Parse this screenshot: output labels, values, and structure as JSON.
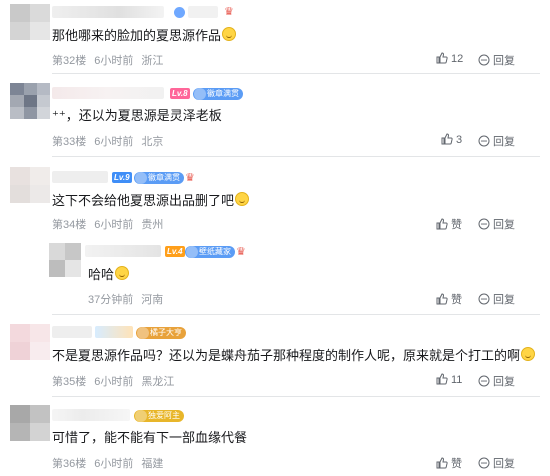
{
  "comments": [
    {
      "level": "",
      "medal": "",
      "text": "那他哪来的脸加的夏思源作品",
      "floor": "第32楼",
      "time": "6小时前",
      "region": "浙江",
      "likes": "12",
      "reply": "回复"
    },
    {
      "level": "Lv.8",
      "medal": "徽章满贯",
      "text": "⁺⁺，还以为夏思源是灵泽老板",
      "floor": "第33楼",
      "time": "6小时前",
      "region": "北京",
      "likes": "3",
      "reply": "回复"
    },
    {
      "level": "Lv.9",
      "medal": "徽章满贯",
      "text": "这下不会给他夏思源出品删了吧",
      "floor": "第34楼",
      "time": "6小时前",
      "region": "贵州",
      "likes": "赞",
      "reply": "回复"
    },
    {
      "level": "Lv.4",
      "medal": "壁纸藏家",
      "text": "哈哈",
      "floor": "",
      "time": "37分钟前",
      "region": "河南",
      "likes": "赞",
      "reply": "回复"
    },
    {
      "level": "",
      "medal": "橘子大亨",
      "text": "不是夏思源作品吗？还以为是蝶舟茄子那种程度的制作人呢，原来就是个打工的啊",
      "floor": "第35楼",
      "time": "6小时前",
      "region": "黑龙江",
      "likes": "11",
      "reply": "回复"
    },
    {
      "level": "",
      "medal": "独爱阿主",
      "text": "可惜了，能不能有下一部血缘代餐",
      "floor": "第36楼",
      "time": "6小时前",
      "region": "福建",
      "likes": "赞",
      "reply": "回复"
    }
  ]
}
